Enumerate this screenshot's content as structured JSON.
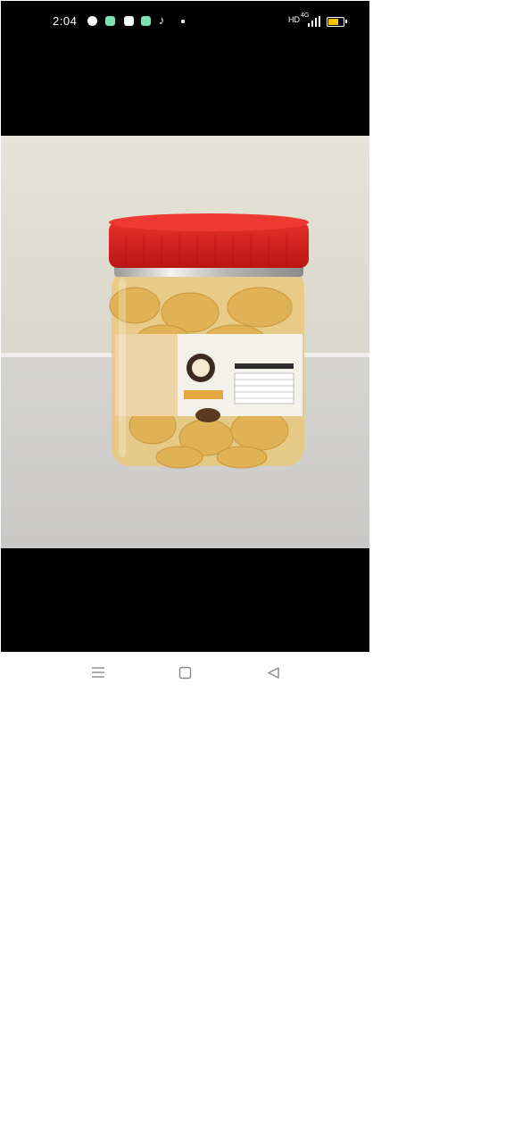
{
  "status_bar": {
    "time": "2:04",
    "network": "4G",
    "hd_label": "HD",
    "battery_level": 0.8
  },
  "notification_icons": [
    "messenger-icon",
    "sms-icon",
    "store-icon",
    "chat-icon",
    "tiktok-icon"
  ],
  "photo": {
    "subject": "plastic-jar-with-red-lid"
  },
  "nav_bar": {
    "icons": [
      "menu-icon",
      "home-icon",
      "back-icon"
    ]
  },
  "colors": {
    "screen_bg": "#000000",
    "page_bg": "#ffffff",
    "lid_red": "#d81f1f",
    "battery_yellow": "#f5c400"
  }
}
